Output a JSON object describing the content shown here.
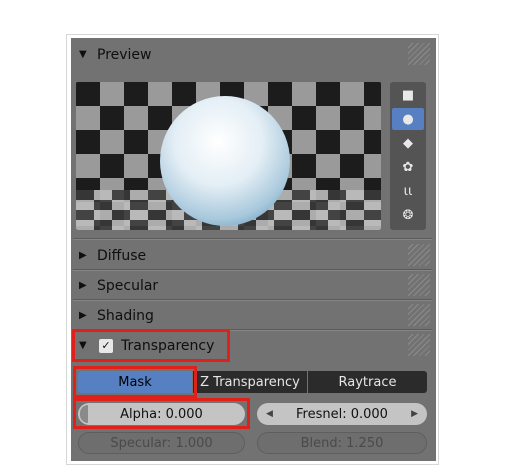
{
  "preview": {
    "header_label": "Preview",
    "types": [
      {
        "icon": "plane-icon",
        "glyph": "■"
      },
      {
        "icon": "sphere-icon",
        "glyph": "●"
      },
      {
        "icon": "cube-icon",
        "glyph": "◆"
      },
      {
        "icon": "monkey-icon",
        "glyph": "✿"
      },
      {
        "icon": "hair-icon",
        "glyph": "ɩɩ"
      },
      {
        "icon": "sphere-and-cube-icon",
        "glyph": "❂"
      }
    ],
    "active_type": 1
  },
  "sections": [
    {
      "label": "Diffuse"
    },
    {
      "label": "Specular"
    },
    {
      "label": "Shading"
    }
  ],
  "transparency": {
    "label": "Transparency",
    "enabled": true,
    "modes": [
      "Mask",
      "Z Transparency",
      "Raytrace"
    ],
    "active_mode": "Mask",
    "alpha_label": "Alpha: 0.000",
    "fresnel_label": "Fresnel: 0.000",
    "specular_label": "Specular: 1.000",
    "blend_label": "Blend: 1.250"
  },
  "colors": {
    "panel_bg": "#727272",
    "active_blue": "#5680c2",
    "highlight_red": "#e0201a"
  }
}
